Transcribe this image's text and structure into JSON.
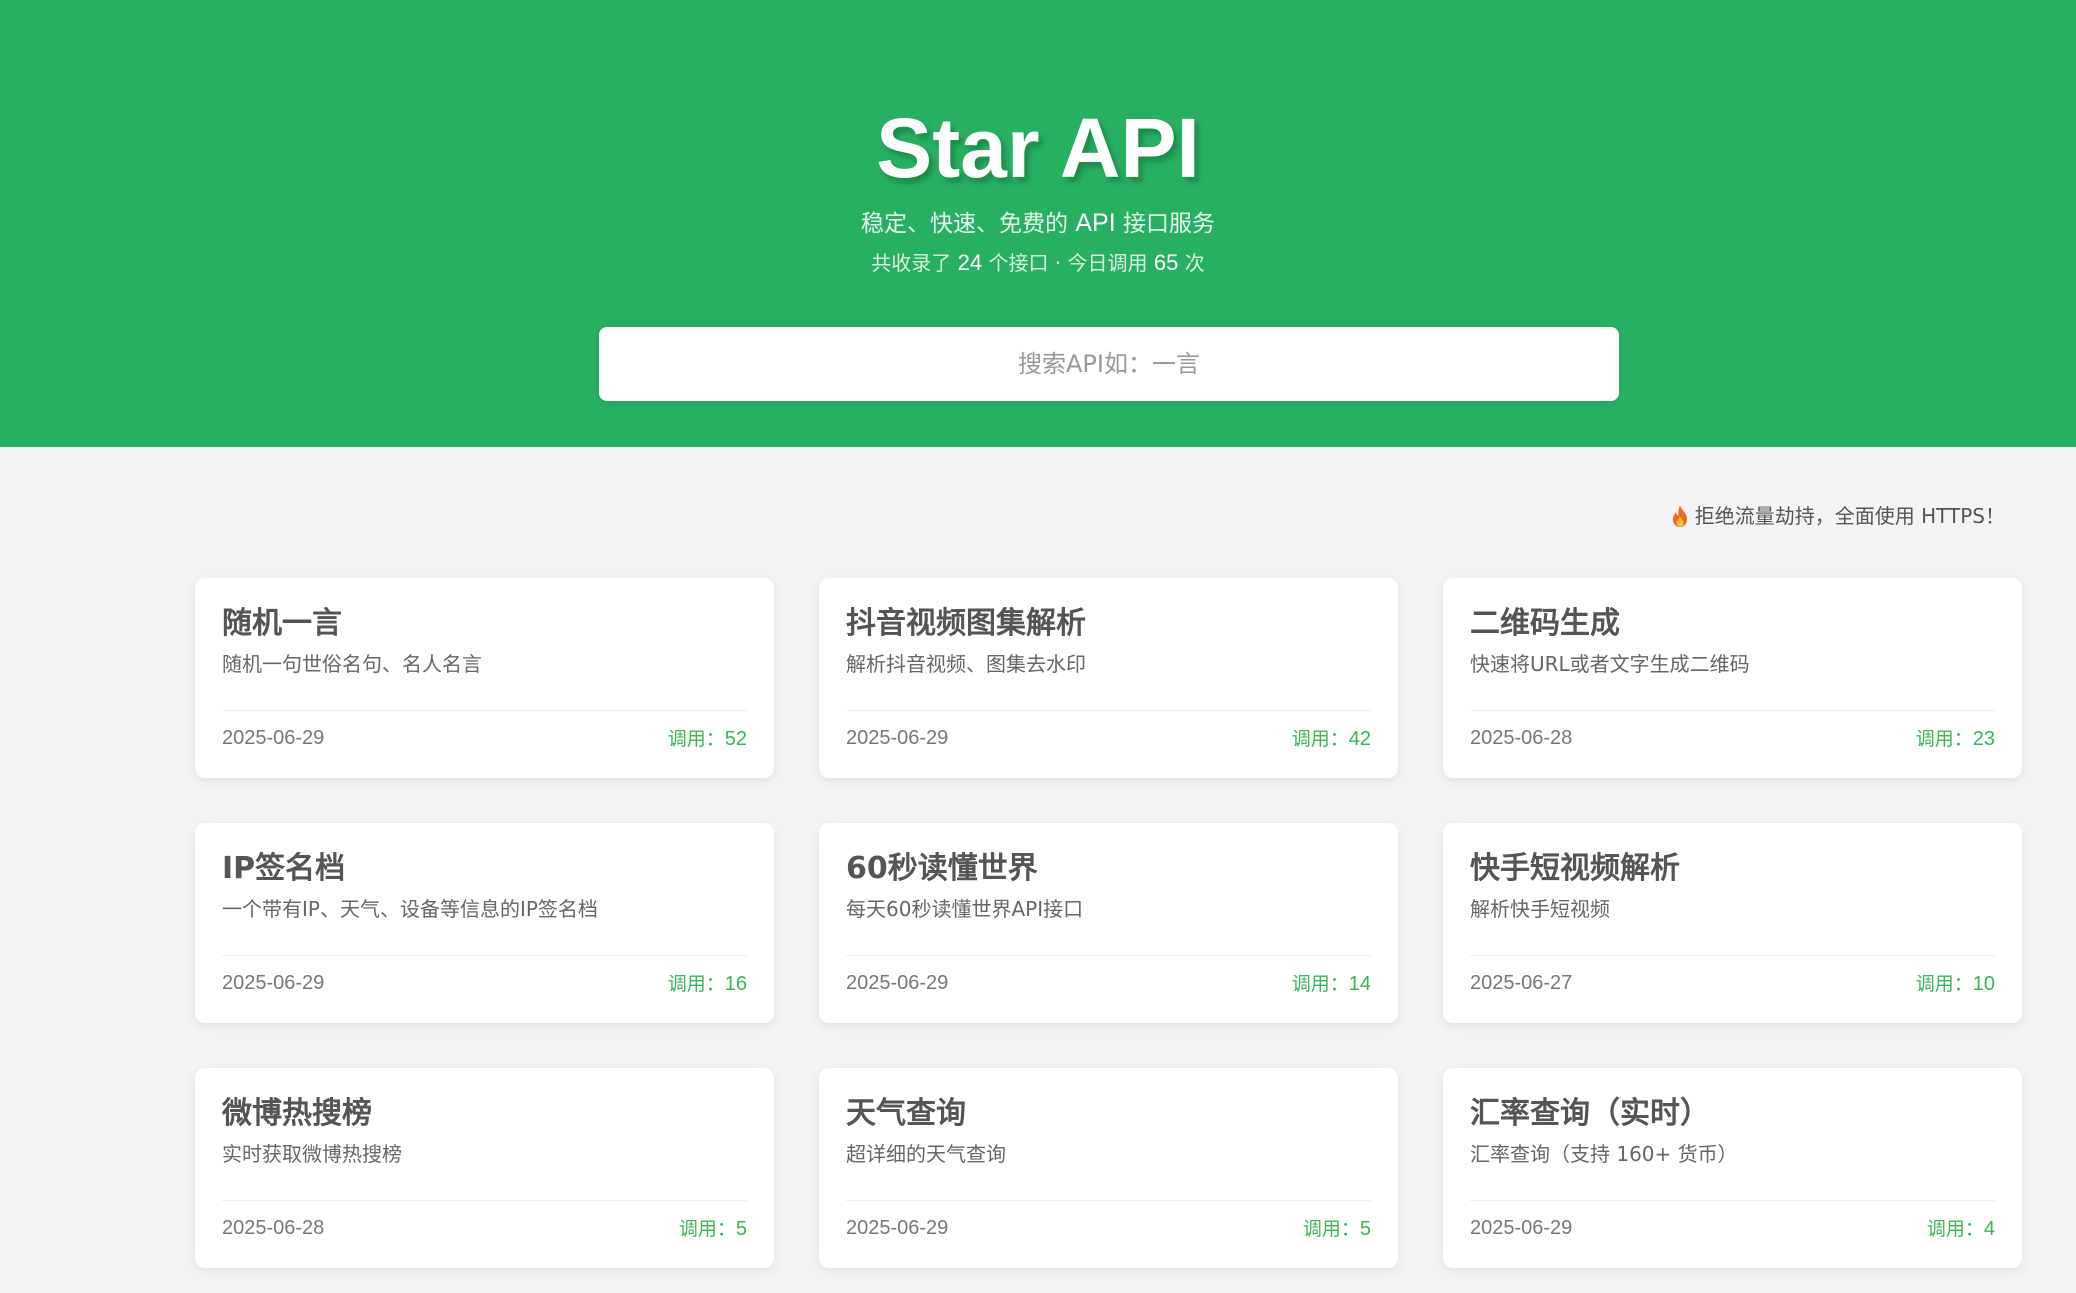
{
  "header": {
    "title": "Star API",
    "subtitle_prefix": "稳定、快速、免费的",
    "subtitle_api": "API",
    "subtitle_suffix": "接口服务",
    "stats_prefix": "共收录了",
    "api_count": "24",
    "stats_middle": "个接口 · 今日调用",
    "call_count": "65",
    "stats_suffix": "次"
  },
  "search": {
    "placeholder": "搜索API如：一言",
    "value": ""
  },
  "notice": {
    "icon": "fire-icon",
    "text": "拒绝流量劫持，全面使用 HTTPS！"
  },
  "colors": {
    "brand_green": "#28b062",
    "calls_green": "#3cb45a",
    "background": "#f4f4f4"
  },
  "cards": [
    {
      "title": "随机一言",
      "desc": "随机一句世俗名句、名人名言",
      "date": "2025-06-29",
      "calls_label": "调用：",
      "calls": "52"
    },
    {
      "title": "抖音视频图集解析",
      "desc": "解析抖音视频、图集去水印",
      "date": "2025-06-29",
      "calls_label": "调用：",
      "calls": "42"
    },
    {
      "title": "二维码生成",
      "desc": "快速将URL或者文字生成二维码",
      "date": "2025-06-28",
      "calls_label": "调用：",
      "calls": "23"
    },
    {
      "title": "IP签名档",
      "desc": "一个带有IP、天气、设备等信息的IP签名档",
      "date": "2025-06-29",
      "calls_label": "调用：",
      "calls": "16"
    },
    {
      "title": "60秒读懂世界",
      "desc": "每天60秒读懂世界API接口",
      "date": "2025-06-29",
      "calls_label": "调用：",
      "calls": "14"
    },
    {
      "title": "快手短视频解析",
      "desc": "解析快手短视频",
      "date": "2025-06-27",
      "calls_label": "调用：",
      "calls": "10"
    },
    {
      "title": "微博热搜榜",
      "desc": "实时获取微博热搜榜",
      "date": "2025-06-28",
      "calls_label": "调用：",
      "calls": "5"
    },
    {
      "title": "天气查询",
      "desc": "超详细的天气查询",
      "date": "2025-06-29",
      "calls_label": "调用：",
      "calls": "5"
    },
    {
      "title": "汇率查询（实时）",
      "desc": "汇率查询（支持 160+ 货币）",
      "date": "2025-06-29",
      "calls_label": "调用：",
      "calls": "4"
    }
  ]
}
